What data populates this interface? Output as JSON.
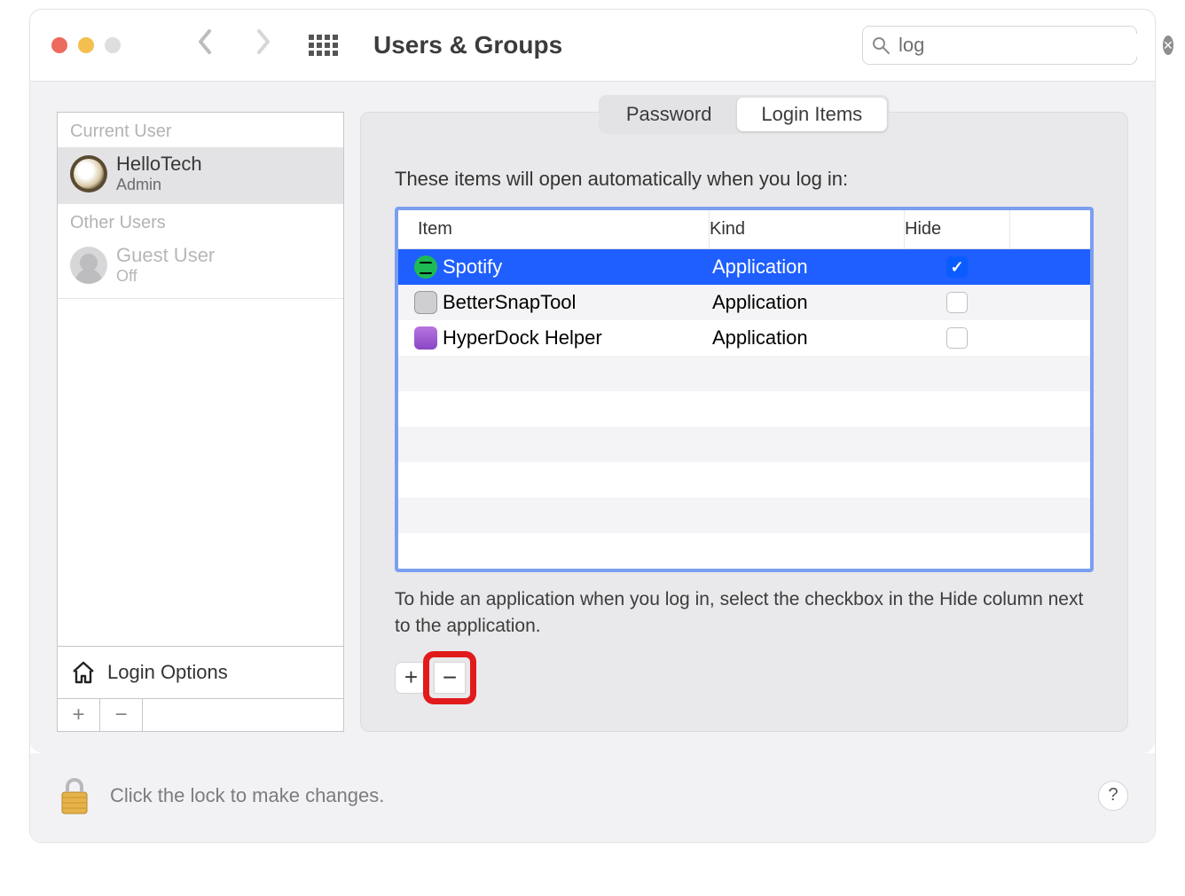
{
  "toolbar": {
    "title": "Users & Groups",
    "search_value": "log"
  },
  "sidebar": {
    "current_label": "Current User",
    "other_label": "Other Users",
    "current_user": {
      "name": "HelloTech",
      "role": "Admin"
    },
    "guest_user": {
      "name": "Guest User",
      "role": "Off"
    },
    "login_options": "Login Options"
  },
  "tabs": {
    "password": "Password",
    "login_items": "Login Items"
  },
  "main": {
    "intro": "These items will open automatically when you log in:",
    "columns": {
      "item": "Item",
      "kind": "Kind",
      "hide": "Hide"
    },
    "rows": [
      {
        "name": "Spotify",
        "kind": "Application",
        "hide": true,
        "icon": "spotify",
        "selected": true
      },
      {
        "name": "BetterSnapTool",
        "kind": "Application",
        "hide": false,
        "icon": "bst",
        "selected": false
      },
      {
        "name": "HyperDock Helper",
        "kind": "Application",
        "hide": false,
        "icon": "hd",
        "selected": false
      }
    ],
    "hint": "To hide an application when you log in, select the checkbox in the Hide column next to the application."
  },
  "footer": {
    "lock_text": "Click the lock to make changes."
  }
}
